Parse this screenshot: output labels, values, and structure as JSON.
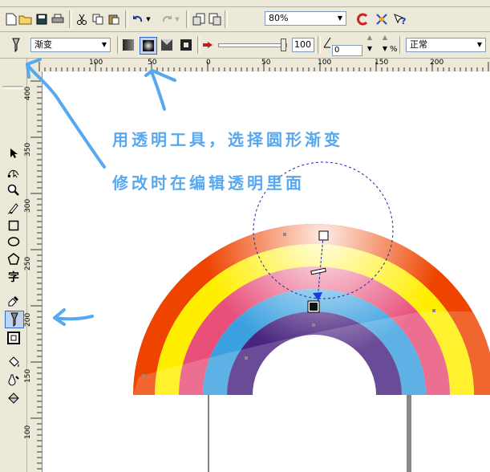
{
  "toolbar": {
    "zoom_value": "80%"
  },
  "propbar": {
    "fill_type": "渐变",
    "slider_value": "100",
    "angle_value": "0",
    "percent_sign": "%",
    "merge_mode": "正常"
  },
  "ruler": {
    "h_ticks": [
      "100",
      "50",
      "0",
      "50",
      "100",
      "150",
      "200"
    ],
    "v_ticks": [
      "400",
      "350",
      "300",
      "250",
      "200",
      "150",
      "100"
    ]
  },
  "annotation": {
    "line1": "用透明工具，选择圆形渐变",
    "line2": "修改时在编辑透明里面"
  },
  "colors": {
    "annotation_blue": "#58a8f0",
    "rainbow_red": "#ee4400",
    "rainbow_yellow": "#ffee00",
    "rainbow_pink": "#e8507a",
    "rainbow_blue": "#3aa0e0",
    "rainbow_purple": "#4a2480"
  },
  "icons": {
    "toolbar": [
      "new-icon",
      "open-icon",
      "save-icon",
      "print-icon",
      "cut-icon",
      "copy-icon",
      "paste-icon",
      "undo-icon",
      "redo-icon",
      "import-icon",
      "export-icon",
      "corel-icon",
      "application-launcher-icon",
      "help-icon"
    ],
    "toolbox": [
      "pick-tool-icon",
      "shape-tool-icon",
      "zoom-tool-icon",
      "freehand-tool-icon",
      "rectangle-tool-icon",
      "ellipse-tool-icon",
      "polygon-tool-icon",
      "text-tool-icon",
      "eyedropper-tool-icon",
      "interactive-transparency-tool-icon",
      "outline-tool-icon",
      "fill-tool-icon",
      "interactive-fill-tool-icon",
      "smart-fill-tool-icon"
    ]
  }
}
